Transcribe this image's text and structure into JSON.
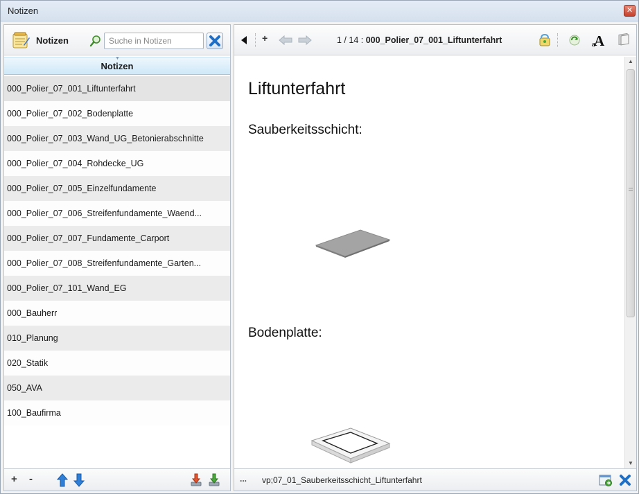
{
  "window": {
    "title": "Notizen"
  },
  "left_toolbar": {
    "label": "Notizen",
    "search_placeholder": "Suche in Notizen"
  },
  "list": {
    "header": "Notizen",
    "items": [
      "000_Polier_07_001_Liftunterfahrt",
      "000_Polier_07_002_Bodenplatte",
      "000_Polier_07_003_Wand_UG_Betonierabschnitte",
      "000_Polier_07_004_Rohdecke_UG",
      "000_Polier_07_005_Einzelfundamente",
      "000_Polier_07_006_Streifenfundamente_Waend...",
      "000_Polier_07_007_Fundamente_Carport",
      "000_Polier_07_008_Streifenfundamente_Garten...",
      "000_Polier_07_101_Wand_EG",
      "000_Bauherr",
      "010_Planung",
      "020_Statik",
      "050_AVA",
      "100_Baufirma"
    ],
    "selected_index": 0
  },
  "left_bottom": {
    "add_label": "+",
    "remove_label": "-"
  },
  "right_toolbar": {
    "add_label": "+",
    "position": "1 / 14 :",
    "note_title": "000_Polier_07_001_Liftunterfahrt"
  },
  "content": {
    "heading": "Liftunterfahrt",
    "section1": "Sauberkeitsschicht:",
    "section2": "Bodenplatte:"
  },
  "status": {
    "more": "...",
    "path": "vp;07_01_Sauberkeitsschicht_Liftunterfahrt"
  },
  "icons": {
    "close_window": "close-icon",
    "notes_logo": "notepad-icon",
    "search": "magnifier-icon",
    "clear_search": "blue-x-icon",
    "move_up": "blue-arrow-up-icon",
    "move_down": "blue-arrow-down-icon",
    "prev": "black-triangle-left-icon",
    "back": "grey-arrow-left-icon",
    "forward": "grey-arrow-right-icon",
    "font": "font-a-icon"
  },
  "colors": {
    "accent_blue": "#2f7fd6",
    "list_header": "#cfe8f8",
    "close_red": "#c4402b"
  }
}
